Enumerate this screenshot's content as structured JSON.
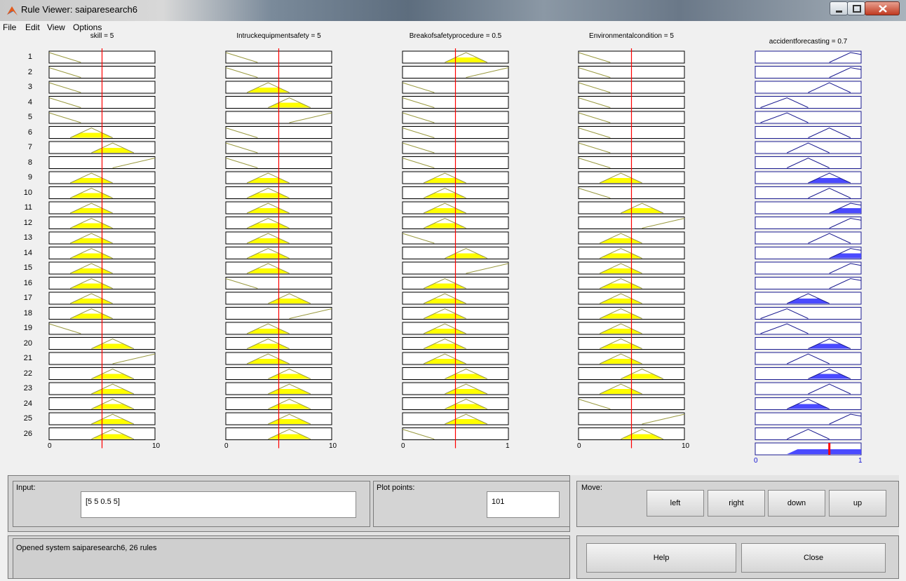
{
  "window": {
    "title": "Rule Viewer: saiparesearch6"
  },
  "menu": [
    "File",
    "Edit",
    "View",
    "Options"
  ],
  "variables": [
    {
      "title": "skill = 5",
      "range": [
        0,
        10
      ],
      "tick_min": "0",
      "tick_max": "10",
      "value": 5
    },
    {
      "title": "Intruckequipmentsafety = 5",
      "range": [
        0,
        10
      ],
      "tick_min": "0",
      "tick_max": "10",
      "value": 5
    },
    {
      "title": "Breakofsafetyprocedure = 0.5",
      "range": [
        0,
        1
      ],
      "tick_min": "0",
      "tick_max": "1",
      "value": 0.5
    },
    {
      "title": "Environmentalcondition = 5",
      "range": [
        0,
        10
      ],
      "tick_min": "0",
      "tick_max": "10",
      "value": 5
    }
  ],
  "output": {
    "title": "accidentforecasting = 0.7",
    "range": [
      0,
      1
    ],
    "tick_min": "0",
    "tick_max": "1",
    "value": 0.7
  },
  "rules": [
    {
      "n": "1",
      "mf": [
        "L",
        "L",
        "H",
        "L",
        "VH"
      ],
      "out_fill": 0
    },
    {
      "n": "2",
      "mf": [
        "L",
        "L",
        "VH",
        "L",
        "VH"
      ],
      "out_fill": 0
    },
    {
      "n": "3",
      "mf": [
        "L",
        "M",
        "L",
        "L",
        "H"
      ],
      "out_fill": 0
    },
    {
      "n": "4",
      "mf": [
        "L",
        "H",
        "L",
        "L",
        "VL"
      ],
      "out_fill": 0
    },
    {
      "n": "5",
      "mf": [
        "L",
        "VH",
        "L",
        "L",
        "VL"
      ],
      "out_fill": 0
    },
    {
      "n": "6",
      "mf": [
        "M",
        "L",
        "L",
        "L",
        "H"
      ],
      "out_fill": 0
    },
    {
      "n": "7",
      "mf": [
        "H",
        "L",
        "L",
        "L",
        "M"
      ],
      "out_fill": 0
    },
    {
      "n": "8",
      "mf": [
        "VH",
        "L",
        "L",
        "L",
        "M"
      ],
      "out_fill": 0
    },
    {
      "n": "9",
      "mf": [
        "M",
        "M",
        "M",
        "M",
        "H"
      ],
      "out_fill": 0.5
    },
    {
      "n": "10",
      "mf": [
        "M",
        "M",
        "M",
        "L",
        "H"
      ],
      "out_fill": 0
    },
    {
      "n": "11",
      "mf": [
        "M",
        "M",
        "M",
        "H",
        "VH"
      ],
      "out_fill": 0.5
    },
    {
      "n": "12",
      "mf": [
        "M",
        "M",
        "M",
        "VH",
        "VH"
      ],
      "out_fill": 0
    },
    {
      "n": "13",
      "mf": [
        "M",
        "M",
        "L",
        "M",
        "H"
      ],
      "out_fill": 0
    },
    {
      "n": "14",
      "mf": [
        "M",
        "M",
        "H",
        "M",
        "VH"
      ],
      "out_fill": 0.5
    },
    {
      "n": "15",
      "mf": [
        "M",
        "M",
        "VH",
        "M",
        "VH"
      ],
      "out_fill": 0
    },
    {
      "n": "16",
      "mf": [
        "M",
        "L",
        "M",
        "M",
        "VH"
      ],
      "out_fill": 0
    },
    {
      "n": "17",
      "mf": [
        "M",
        "H",
        "M",
        "M",
        "M"
      ],
      "out_fill": 0.5
    },
    {
      "n": "18",
      "mf": [
        "M",
        "VH",
        "M",
        "M",
        "VL"
      ],
      "out_fill": 0
    },
    {
      "n": "19",
      "mf": [
        "L",
        "M",
        "M",
        "M",
        "VL"
      ],
      "out_fill": 0
    },
    {
      "n": "20",
      "mf": [
        "H",
        "M",
        "M",
        "M",
        "H"
      ],
      "out_fill": 0.5
    },
    {
      "n": "21",
      "mf": [
        "VH",
        "M",
        "M",
        "M",
        "M"
      ],
      "out_fill": 0
    },
    {
      "n": "22",
      "mf": [
        "H",
        "H",
        "H",
        "H",
        "H"
      ],
      "out_fill": 0.5
    },
    {
      "n": "23",
      "mf": [
        "H",
        "H",
        "H",
        "M",
        "H"
      ],
      "out_fill": 0
    },
    {
      "n": "24",
      "mf": [
        "H",
        "H",
        "H",
        "L",
        "M"
      ],
      "out_fill": 0.5
    },
    {
      "n": "25",
      "mf": [
        "H",
        "H",
        "H",
        "VH",
        "VH"
      ],
      "out_fill": 0
    },
    {
      "n": "26",
      "mf": [
        "H",
        "H",
        "L",
        "H",
        "M"
      ],
      "out_fill": 0
    }
  ],
  "controls": {
    "input_label": "Input:",
    "input_value": "[5 5 0.5 5]",
    "plot_points_label": "Plot points:",
    "plot_points_value": "101",
    "move_label": "Move:",
    "buttons": {
      "left": "left",
      "right": "right",
      "down": "down",
      "up": "up",
      "help": "Help",
      "close": "Close"
    },
    "status": "Opened system saiparesearch6, 26 rules"
  },
  "colors": {
    "input_fill": "#ffff00",
    "output_fill": "#4a4aff",
    "indicator": "#ff0000",
    "mf_input": "#9a9a40",
    "mf_output": "#1a1a90"
  }
}
